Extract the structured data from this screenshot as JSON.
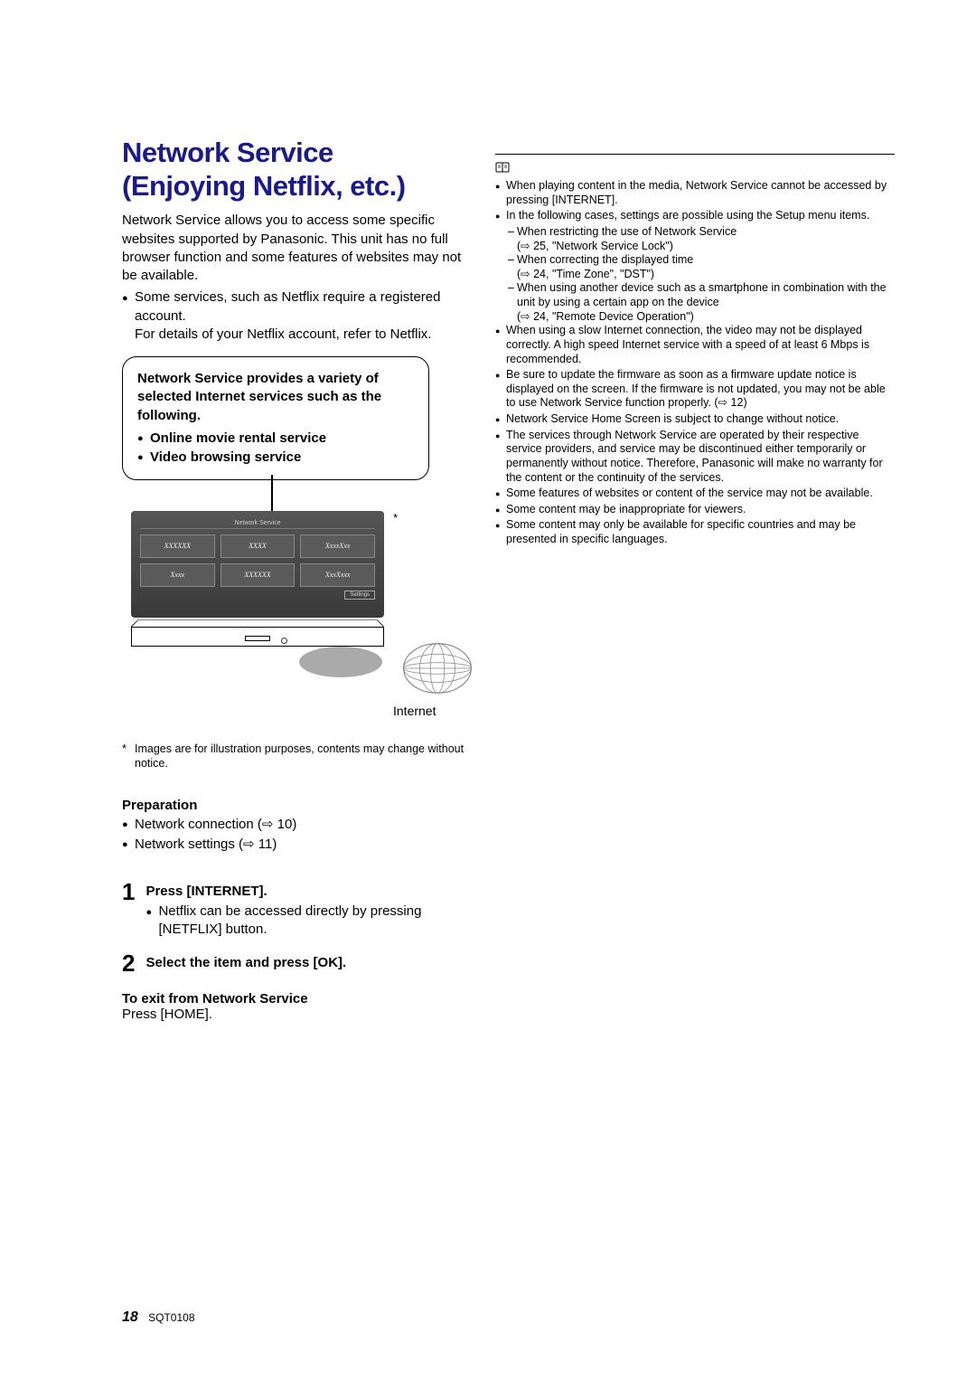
{
  "title_line1": "Network Service",
  "title_line2": "(Enjoying Netflix, etc.)",
  "intro": "Network Service allows you to access some specific websites supported by Panasonic. This unit has no full browser function and some features of websites may not be available.",
  "intro_bullet": "Some services, such as Netflix require a registered account.",
  "intro_sub": "For details of your Netflix account, refer to Netflix.",
  "callout": {
    "title": "Network Service provides a variety of selected Internet services such as the following.",
    "items": [
      "Online movie rental service",
      "Video browsing service"
    ]
  },
  "diagram": {
    "tv_header": "Network Service",
    "tiles": [
      "XXXXXX",
      "XXXX",
      "XxxxXxx",
      "Xxxx",
      "XXXXXX",
      "XxxXxxx"
    ],
    "settings_label": "Settings",
    "star": "*",
    "internet_label": "Internet"
  },
  "footnote": {
    "mark": "*",
    "text": "Images are for illustration purposes, contents may change without notice."
  },
  "preparation": {
    "heading": "Preparation",
    "items": [
      "Network connection (⇨ 10)",
      "Network settings (⇨ 11)"
    ]
  },
  "steps": [
    {
      "num": "1",
      "title": "Press [INTERNET].",
      "sub": "Netflix can be accessed directly by pressing [NETFLIX] button."
    },
    {
      "num": "2",
      "title": "Select the item and press [OK].",
      "sub": ""
    }
  ],
  "exit": {
    "title": "To exit from Network Service",
    "body": "Press [HOME]."
  },
  "notes": [
    {
      "t": "bullet",
      "v": "When playing content in the media, Network Service cannot be accessed by pressing [INTERNET]."
    },
    {
      "t": "bullet",
      "v": "In the following cases, settings are possible using the Setup menu items."
    },
    {
      "t": "sub",
      "v": "When restricting the use of Network Service"
    },
    {
      "t": "ref",
      "v": "(⇨ 25, \"Network Service Lock\")"
    },
    {
      "t": "sub",
      "v": "When correcting the displayed time"
    },
    {
      "t": "ref",
      "v": "(⇨ 24, \"Time Zone\", \"DST\")"
    },
    {
      "t": "sub",
      "v": "When using another device such as a smartphone in combination with the unit by using a certain app on the device"
    },
    {
      "t": "ref",
      "v": "(⇨ 24, \"Remote Device Operation\")"
    },
    {
      "t": "bullet",
      "v": "When using a slow Internet connection, the video may not be displayed correctly. A high speed Internet service with a speed of at least 6 Mbps is recommended."
    },
    {
      "t": "bullet",
      "v": "Be sure to update the firmware as soon as a firmware update notice is displayed on the screen. If the firmware is not updated, you may not be able to use Network Service function properly. (⇨ 12)"
    },
    {
      "t": "bullet",
      "v": "Network Service Home Screen is subject to change without notice."
    },
    {
      "t": "bullet",
      "v": "The services through Network Service are operated by their respective service providers, and service may be discontinued either temporarily or permanently without notice. Therefore, Panasonic will make no warranty for the content or the continuity of the services."
    },
    {
      "t": "bullet",
      "v": "Some features of websites or content of the service may not be available."
    },
    {
      "t": "bullet",
      "v": "Some content may be inappropriate for viewers."
    },
    {
      "t": "bullet",
      "v": "Some content may only be available for specific countries and may be presented in specific languages."
    }
  ],
  "footer": {
    "page": "18",
    "doc": "SQT0108"
  }
}
